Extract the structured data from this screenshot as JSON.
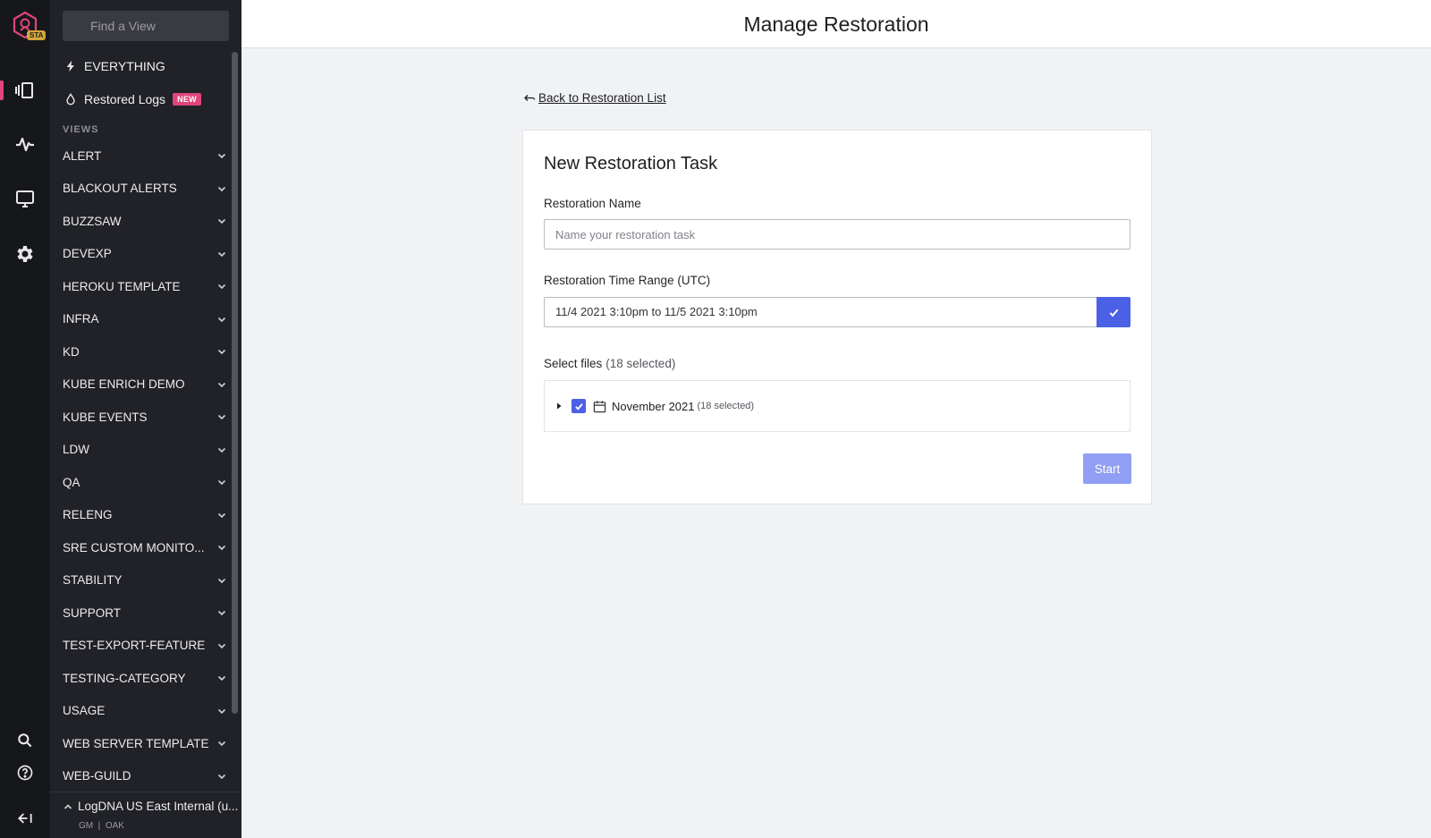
{
  "rail": {
    "env_badge": "STA",
    "icons": [
      "logo-icon",
      "views-icon",
      "activity-icon",
      "monitor-icon",
      "gear-icon",
      "search-icon",
      "help-icon",
      "collapse-icon"
    ]
  },
  "sidebar": {
    "search_placeholder": "Find a View",
    "top_items": [
      {
        "label": "EVERYTHING",
        "icon": "bolt-icon"
      },
      {
        "label": "Restored Logs",
        "icon": "drop-icon",
        "badge": "NEW"
      }
    ],
    "views_header": "VIEWS",
    "views": [
      "ALERT",
      "BLACKOUT ALERTS",
      "BUZZSAW",
      "DEVEXP",
      "HEROKU TEMPLATE",
      "INFRA",
      "KD",
      "KUBE ENRICH DEMO",
      "KUBE EVENTS",
      "LDW",
      "QA",
      "RELENG",
      "SRE CUSTOM MONITO...",
      "STABILITY",
      "SUPPORT",
      "TEST-EXPORT-FEATURE",
      "TESTING-CATEGORY",
      "USAGE",
      "WEB SERVER TEMPLATE",
      "WEB-GUILD"
    ],
    "footer": {
      "account": "LogDNA US East Internal (u...",
      "sub": "GM  |  OAK"
    }
  },
  "header": {
    "title": "Manage Restoration"
  },
  "main": {
    "back_link": "Back to Restoration List",
    "card": {
      "title": "New Restoration Task",
      "name_label": "Restoration Name",
      "name_placeholder": "Name your restoration task",
      "name_value": "",
      "range_label": "Restoration Time Range (UTC)",
      "range_value": "11/4 2021 3:10pm to 11/5 2021 3:10pm",
      "files_label": "Select files",
      "files_count": "(18 selected)",
      "tree": [
        {
          "label": "November 2021",
          "count": "(18 selected)",
          "checked": true,
          "expanded": false
        }
      ],
      "start_label": "Start"
    }
  },
  "colors": {
    "accent": "#4a61e6",
    "accent_disabled": "#909ff3",
    "brand": "#e0457b",
    "sidebar_bg": "#212227",
    "rail_bg": "#16171b"
  }
}
